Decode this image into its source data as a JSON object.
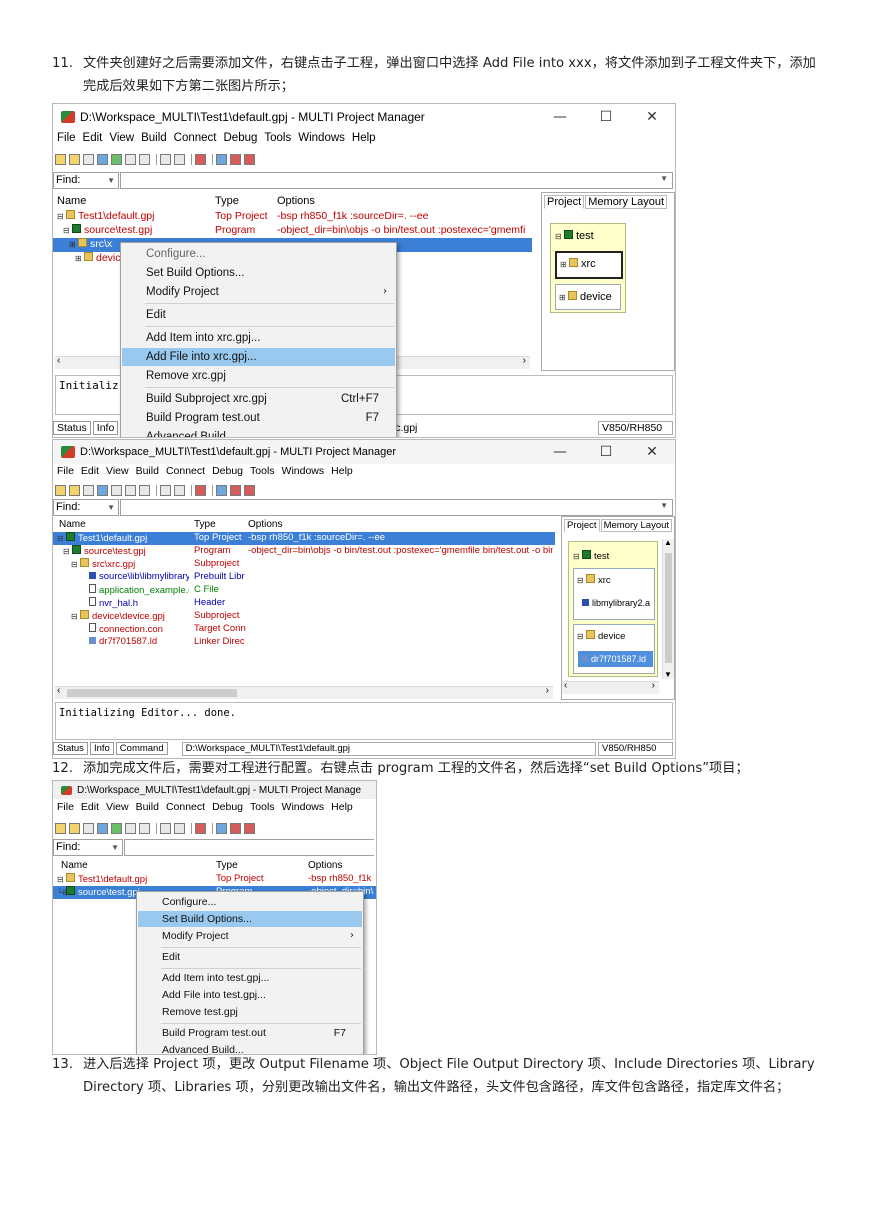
{
  "steps": [
    {
      "num": "11.",
      "text": "文件夹创建好之后需要添加文件，右键点击子工程，弹出窗口中选择 Add File into xxx，将文件添加到子工程文件夹下，添加完成后效果如下方第二张图片所示；"
    },
    {
      "num": "12.",
      "text": "添加完成文件后，需要对工程进行配置。右键点击 program 工程的文件名，然后选择“set Build Options”项目；"
    },
    {
      "num": "13.",
      "text": "进入后选择 Project 项，更改 Output Filename 项、Object File Output Directory 项、Include Directories 项、Library Directory 项、Libraries 项，分别更改输出文件名，输出文件路径，头文件包含路径，库文件包含路径，指定库文件名；"
    }
  ],
  "window": {
    "title": "D:\\Workspace_MULTI\\Test1\\default.gpj - MULTI Project Manager",
    "title_trunc": "D:\\Workspace_MULTI\\Test1\\default.gpj - MULTI Project Manage",
    "minimize": "—",
    "maximize": "☐",
    "close": "✕",
    "menu": [
      "File",
      "Edit",
      "View",
      "Build",
      "Connect",
      "Debug",
      "Tools",
      "Windows",
      "Help"
    ],
    "find_label": "Find:",
    "columns": {
      "name": "Name",
      "type": "Type",
      "options": "Options"
    },
    "tabs": {
      "project": "Project",
      "memory": "Memory Layout"
    },
    "status_tabs": {
      "status": "Status",
      "info": "Info",
      "command": "Command"
    },
    "status_path": "D:\\Workspace_MULTI\\Test1\\default.gpj",
    "status_target": "V850/RH850",
    "init_text": "Initializing Editor... done.",
    "init_trunc": "Initializ"
  },
  "shot1": {
    "rows": [
      {
        "name": "Test1\\default.gpj",
        "type": "Top Project",
        "options": "-bsp rh850_f1k :sourceDir=. --ee"
      },
      {
        "name": "source\\test.gpj",
        "type": "Program",
        "options": "-object_dir=bin\\objs -o bin/test.out :postexec='gmemfi"
      },
      {
        "name": "src\\x",
        "type": "",
        "options": ""
      },
      {
        "name": "devic",
        "type": "",
        "options": ""
      }
    ],
    "status_path_frag": "c\\xrc.gpj",
    "layout": {
      "top": "test",
      "sub1": "xrc",
      "sub2": "device"
    },
    "context_menu": [
      "Configure...",
      "Set Build Options...",
      "Modify Project",
      "Edit",
      "Add Item into xrc.gpj...",
      "Add File into xrc.gpj...",
      "Remove xrc.gpj",
      "Build Subproject xrc.gpj",
      "Build Program test.out",
      "Advanced Build..."
    ],
    "shortcuts": {
      "build_sub": "Ctrl+F7",
      "build_prog": "F7"
    }
  },
  "shot2": {
    "rows": [
      {
        "name": "Test1\\default.gpj",
        "type": "Top Project",
        "options": "-bsp rh850_f1k :sourceDir=. --ee"
      },
      {
        "name": "source\\test.gpj",
        "type": "Program",
        "options": "-object_dir=bin\\objs -o bin/test.out :postexec='gmemfile bin/test.out -o bin/t"
      },
      {
        "name": "src\\xrc.gpj",
        "type": "Subproject",
        "options": ""
      },
      {
        "name": "source\\lib\\libmylibrary",
        "type": "Prebuilt Libr",
        "options": ""
      },
      {
        "name": "application_example.c",
        "type": "C File",
        "options": ""
      },
      {
        "name": "nvr_hal.h",
        "type": "Header",
        "options": ""
      },
      {
        "name": "device\\device.gpj",
        "type": "Subproject",
        "options": ""
      },
      {
        "name": "connection.con",
        "type": "Target Conn",
        "options": ""
      },
      {
        "name": "dr7f701587.ld",
        "type": "Linker Direc",
        "options": ""
      }
    ],
    "layout": {
      "top": "test",
      "sub1": "xrc",
      "sub1_file": "libmylibrary2.a",
      "sub2": "device",
      "sub2_file": "dr7f701587.ld"
    }
  },
  "shot3": {
    "rows": [
      {
        "name": "Test1\\default.gpj",
        "type": "Top Project",
        "options": "-bsp rh850_f1k"
      },
      {
        "name": "source\\test.gpj",
        "type": "Program",
        "options": "-object_dir=bin\\"
      }
    ],
    "context_menu": [
      "Configure...",
      "Set Build Options...",
      "Modify Project",
      "Edit",
      "Add Item into test.gpj...",
      "Add File into test.gpj...",
      "Remove test.gpj",
      "Build Program test.out",
      "Advanced Build..."
    ],
    "shortcut": "F7"
  }
}
